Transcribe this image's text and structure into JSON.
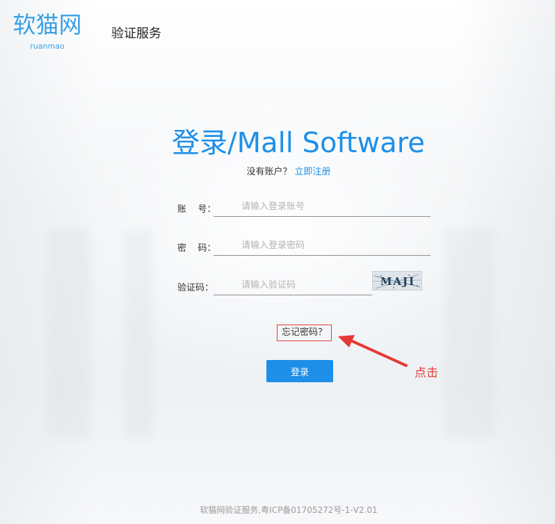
{
  "header": {
    "logo_text": "软猫网",
    "logo_sub": "ruanmao",
    "service_title": "验证服务"
  },
  "login": {
    "title": "登录/Mall Software",
    "no_account_text": "没有账户？",
    "register_link": "立即注册",
    "account_label": "账    号：",
    "account_placeholder": "请输入登录账号",
    "password_label": "密    码：",
    "password_placeholder": "请输入登录密码",
    "captcha_label": "验证码：",
    "captcha_placeholder": "请输入验证码",
    "captcha_text": "MAJI",
    "forgot_link": "忘记密码？",
    "submit_label": "登录"
  },
  "annotation": {
    "text": "点击",
    "color": "#e53935"
  },
  "footer": {
    "text": "软猫网验证服务,粤ICP备01705272号-1-V2.01"
  },
  "colors": {
    "accent": "#1e8fe8",
    "logo": "#3aa0e6",
    "highlight": "#e53935"
  }
}
